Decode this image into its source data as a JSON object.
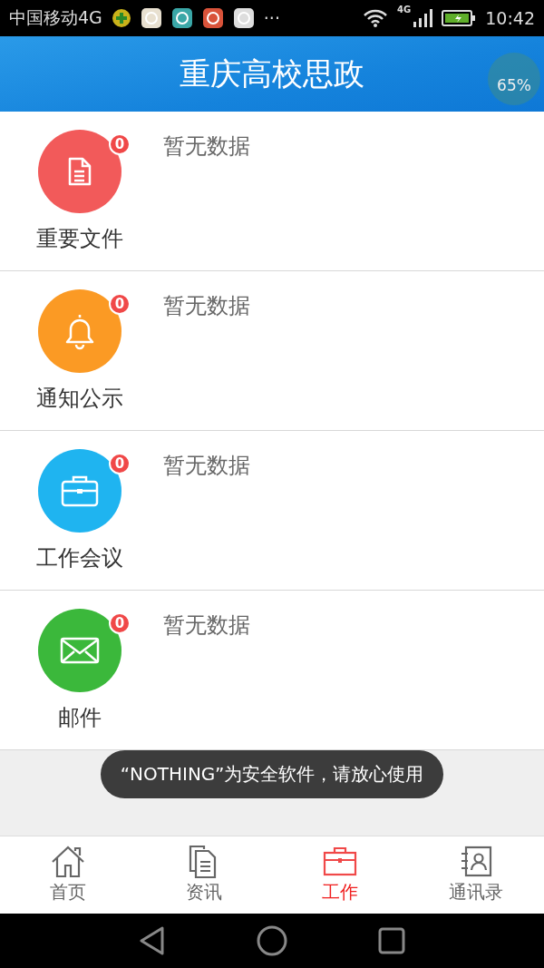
{
  "status_bar": {
    "carrier": "中国移动4G",
    "more": "···",
    "network": "4G",
    "time": "10:42"
  },
  "header": {
    "title": "重庆高校思政",
    "floating_ball": "65%"
  },
  "sections": [
    {
      "kind": "document",
      "label": "重要文件",
      "count": "0",
      "message": "暂无数据",
      "color": "#f25a5a"
    },
    {
      "kind": "bell",
      "label": "通知公示",
      "count": "0",
      "message": "暂无数据",
      "color": "#fb9a24"
    },
    {
      "kind": "briefcase",
      "label": "工作会议",
      "count": "0",
      "message": "暂无数据",
      "color": "#1fb4f0"
    },
    {
      "kind": "mail",
      "label": "邮件",
      "count": "0",
      "message": "暂无数据",
      "color": "#3bb83b"
    }
  ],
  "toast": "“NOTHING”为安全软件，请放心使用",
  "tabs": [
    {
      "kind": "home",
      "label": "首页",
      "selected": false
    },
    {
      "kind": "news",
      "label": "资讯",
      "selected": false
    },
    {
      "kind": "work",
      "label": "工作",
      "selected": true
    },
    {
      "kind": "contacts",
      "label": "通讯录",
      "selected": false
    }
  ]
}
